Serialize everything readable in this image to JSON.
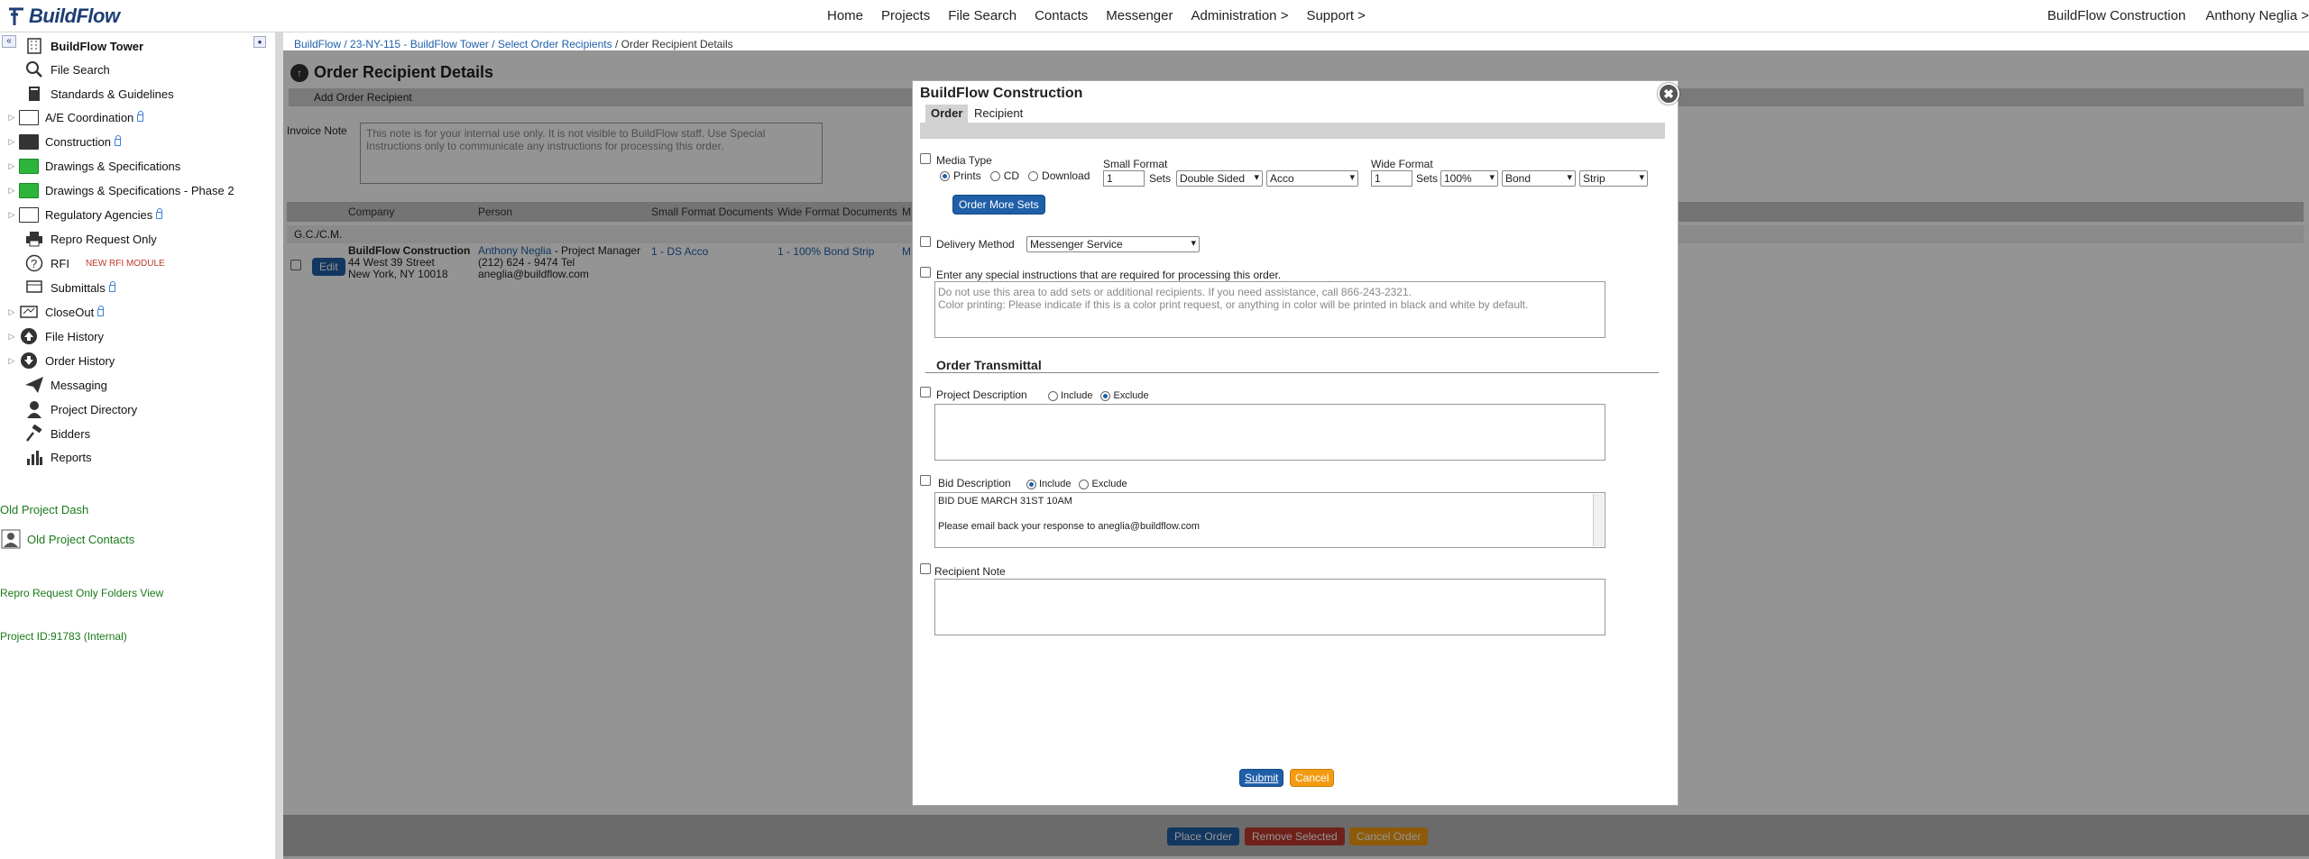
{
  "topbar": {
    "logo": "BuildFlow",
    "nav": [
      "Home",
      "Projects",
      "File Search",
      "Contacts",
      "Messenger",
      "Administration >",
      "Support >"
    ],
    "company": "BuildFlow Construction",
    "user": "Anthony Neglia >"
  },
  "sidebar": {
    "collapse": "«",
    "project": "BuildFlow Tower",
    "items": {
      "file_search": "File Search",
      "standards": "Standards & Guidelines",
      "ae": "A/E Coordination",
      "construction": "Construction",
      "drawings": "Drawings & Specifications",
      "drawings2": "Drawings & Specifications - Phase 2",
      "regulatory": "Regulatory Agencies",
      "repro": "Repro Request Only",
      "rfi": "RFI",
      "rfi_badge": "NEW RFI MODULE",
      "submittals": "Submittals",
      "closeout": "CloseOut",
      "file_history": "File History",
      "order_history": "Order History",
      "messaging": "Messaging",
      "directory": "Project Directory",
      "bidders": "Bidders",
      "reports": "Reports"
    },
    "links": {
      "old_dash": "Old Project Dash",
      "old_contacts": "Old Project Contacts",
      "repro_view": "Repro Request Only Folders View",
      "project_id": "Project ID:91783 (Internal)"
    }
  },
  "main": {
    "breadcrumb": [
      "BuildFlow",
      " / 23-NY-115 - BuildFlow Tower",
      " / Select Order Recipients",
      " / Order Recipient Details"
    ],
    "title": "Order Recipient Details",
    "add_recipient": "Add Order Recipient",
    "invoice_label": "Invoice Note",
    "invoice_placeholder": "This note is for your internal use only.  It is not visible to BuildFlow staff.  Use Special Instructions only to communicate any instructions for processing this order.",
    "columns": [
      "Company",
      "Person",
      "Small Format Documents",
      "Wide Format Documents",
      "M"
    ],
    "group": "G.C./C.M.",
    "row": {
      "edit": "Edit",
      "company": "BuildFlow Construction",
      "address1": "44 West 39 Street",
      "address2": "New York, NY 10018",
      "person": "Anthony Neglia",
      "role": " - Project Manager",
      "phone": "(212) 624 - 9474 Tel",
      "email": "aneglia@buildflow.com",
      "small": "1 - DS Acco",
      "wide": "1 - 100% Bond Strip",
      "m": "M"
    },
    "footer": {
      "place": "Place Order",
      "remove": "Remove Selected",
      "cancel": "Cancel Order"
    }
  },
  "modal": {
    "title": "BuildFlow Construction",
    "close": "✖",
    "tabs": [
      "Order",
      "Recipient"
    ],
    "media_type": "Media Type",
    "media_options": [
      "Prints",
      "CD",
      "Download"
    ],
    "small_format": "Small Format",
    "small_sets": "1",
    "sets_label": "Sets",
    "small_sided": "Double Sided",
    "small_binding": "Acco",
    "wide_format": "Wide Format",
    "wide_sets": "1",
    "wide_scale": "100%",
    "wide_paper": "Bond",
    "wide_binding": "Strip",
    "order_more": "Order More Sets",
    "delivery_label": "Delivery Method",
    "delivery_value": "Messenger Service",
    "special_label": "Enter any special instructions that are required for processing this order.",
    "special_placeholder1": "Do not use this area to add sets or additional recipients. If you need assistance, call 866-243-2321.",
    "special_placeholder2": "Color printing: Please indicate if this is a color print request, or anything in color will be printed in black and white by default.",
    "transmittal": "Order Transmittal",
    "project_desc": "Project Description",
    "include": "Include",
    "exclude": "Exclude",
    "bid_desc": "Bid Description",
    "bid_text1": "BID DUE MARCH 31ST 10AM",
    "bid_text2": "Please email back your response to aneglia@buildflow.com",
    "recipient_note": "Recipient Note",
    "submit": "Submit",
    "cancel": "Cancel"
  },
  "colors": {
    "accent": "#1f5fa8",
    "green": "#2cb53a",
    "orange": "#f39c12",
    "red": "#c0392b"
  }
}
